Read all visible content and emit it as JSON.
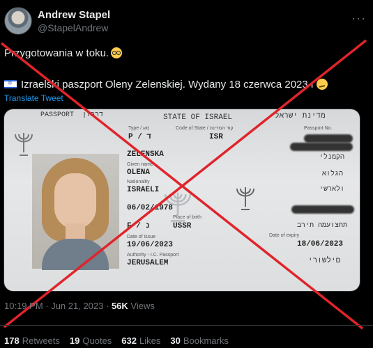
{
  "author": {
    "display_name": "Andrew Stapel",
    "handle": "@StapelAndrew"
  },
  "tweet": {
    "line1": "Przygotowania w toku.",
    "line2": "Izraelski paszport Oleny Zelenskiej. Wydany 18 czerwca 2023 r",
    "translate_label": "Translate Tweet",
    "emoji_line1": "nerd-face-emoji",
    "emoji_line2": "smirk-emoji",
    "flag": "israel-flag-icon"
  },
  "passport": {
    "header_passport": "PASSPORT",
    "header_hebrew_passport": "דרכון",
    "header_state": "STATE OF ISRAEL",
    "header_hebrew_state": "מדינת ישראל",
    "type_label": "Type / סוג",
    "type_value": "P / ד",
    "code_label": "Code of State / קוד המדינה",
    "code_value": "ISR",
    "passport_no_label": "Passport No.",
    "surname_value": "ZELENSKA",
    "given_label": "Given name",
    "given_value": "OLENA",
    "nationality_label": "Nationality",
    "nationality_value": "ISRAELI",
    "dob_value": "06/02/1978",
    "sex_value": "F / נ",
    "pob_label": "Place of birth",
    "pob_value": "USSR",
    "doi_label": "Date of issue",
    "doi_value": "19/06/2023",
    "authority_label": "Authority - I.C. Passport",
    "authority_value": "JERUSALEM",
    "doe_label": "Date of expiry",
    "doe_value": "18/06/2023",
    "heb_1": "הקמנלי",
    "heb_2": "הגלוא",
    "heb_3": "ולארשי",
    "heb_4": "תחצועמה תירב",
    "heb_5": "םילשורי"
  },
  "meta": {
    "time": "10:19 PM · Jun 21, 2023 ·",
    "views_count": "56K",
    "views_label": "Views"
  },
  "stats": {
    "retweets_count": "178",
    "retweets_label": "Retweets",
    "quotes_count": "19",
    "quotes_label": "Quotes",
    "likes_count": "632",
    "likes_label": "Likes",
    "bookmarks_count": "30",
    "bookmarks_label": "Bookmarks"
  },
  "colors": {
    "background": "#000000",
    "text": "#e7e9ea",
    "muted": "#71767b",
    "link": "#1d9bf0",
    "overlay_x": "#e0242b"
  }
}
